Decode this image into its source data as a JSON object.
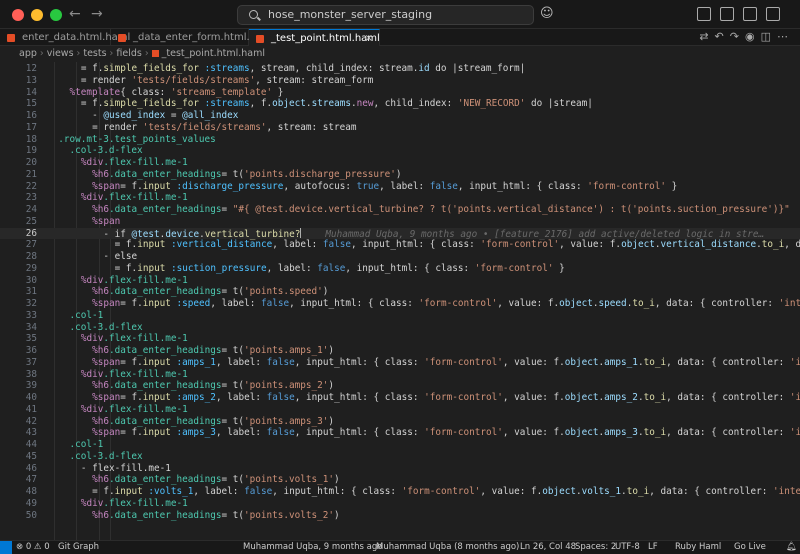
{
  "titlebar": {
    "search_text": "hose_monster_server_staging"
  },
  "tabs": [
    {
      "label": "enter_data.html.haml",
      "active": false
    },
    {
      "label": "_data_enter_form.html.haml",
      "active": false
    },
    {
      "label": "_test_point.html.haml",
      "active": true
    }
  ],
  "breadcrumb": [
    "app",
    "views",
    "tests",
    "fields",
    "_test_point.html.haml"
  ],
  "editor": {
    "current_line": 26,
    "blame": "Muhammad Uqba, 9 months ago • [feature_2176] add active/deleted logic in stre…",
    "lines": [
      {
        "n": 12,
        "indent": 6,
        "tokens": [
          [
            "= f.",
            ""
          ],
          [
            "simple_fields_for",
            "t-method"
          ],
          [
            " ",
            ""
          ],
          [
            ":streams",
            "t-sym"
          ],
          [
            ", stream, child_index: stream.",
            ""
          ],
          [
            "id",
            "t-id"
          ],
          [
            " do |stream_form|",
            ""
          ]
        ]
      },
      {
        "n": 13,
        "indent": 6,
        "tokens": [
          [
            "= render ",
            ""
          ],
          [
            "'tests/fields/streams'",
            "t-str"
          ],
          [
            ", stream: stream_form",
            ""
          ]
        ]
      },
      {
        "n": 14,
        "indent": 4,
        "tokens": [
          [
            "%template",
            "t-tag"
          ],
          [
            "{ class: ",
            ""
          ],
          [
            "'streams_template'",
            "t-str"
          ],
          [
            " }",
            ""
          ]
        ]
      },
      {
        "n": 15,
        "indent": 6,
        "tokens": [
          [
            "= f.",
            ""
          ],
          [
            "simple_fields_for",
            "t-method"
          ],
          [
            " ",
            ""
          ],
          [
            ":streams",
            "t-sym"
          ],
          [
            ", f.",
            ""
          ],
          [
            "object",
            "t-id"
          ],
          [
            ".",
            ""
          ],
          [
            "streams",
            "t-id"
          ],
          [
            ".",
            ""
          ],
          [
            "new",
            "t-kw"
          ],
          [
            ", child_index: ",
            ""
          ],
          [
            "'NEW_RECORD'",
            "t-str"
          ],
          [
            " do |stream|",
            ""
          ]
        ]
      },
      {
        "n": 16,
        "indent": 8,
        "tokens": [
          [
            "- ",
            ""
          ],
          [
            "@used_index",
            "t-ivar"
          ],
          [
            " = ",
            ""
          ],
          [
            "@all_index",
            "t-ivar"
          ]
        ]
      },
      {
        "n": 17,
        "indent": 8,
        "tokens": [
          [
            "= render ",
            ""
          ],
          [
            "'tests/fields/streams'",
            "t-str"
          ],
          [
            ", stream: stream",
            ""
          ]
        ]
      },
      {
        "n": 18,
        "indent": 2,
        "tokens": [
          [
            ".row.mt-3.test_points_values",
            "t-cls"
          ]
        ]
      },
      {
        "n": 19,
        "indent": 4,
        "tokens": [
          [
            ".col-3.d-flex",
            "t-cls"
          ]
        ]
      },
      {
        "n": 20,
        "indent": 6,
        "tokens": [
          [
            "%div",
            "t-tag"
          ],
          [
            ".flex-fill.me-1",
            "t-cls"
          ]
        ]
      },
      {
        "n": 21,
        "indent": 8,
        "tokens": [
          [
            "%h6",
            "t-tag"
          ],
          [
            ".data_enter_headings",
            "t-cls"
          ],
          [
            "= t(",
            ""
          ],
          [
            "'points.discharge_pressure'",
            "t-str"
          ],
          [
            ")",
            ""
          ]
        ]
      },
      {
        "n": 22,
        "indent": 8,
        "tokens": [
          [
            "%span",
            "t-tag"
          ],
          [
            "= f.",
            ""
          ],
          [
            "input",
            "t-method"
          ],
          [
            " ",
            ""
          ],
          [
            ":discharge_pressure",
            "t-sym"
          ],
          [
            ", autofocus: ",
            ""
          ],
          [
            "true",
            "t-const"
          ],
          [
            ", label: ",
            ""
          ],
          [
            "false",
            "t-const"
          ],
          [
            ", input_html: { class: ",
            ""
          ],
          [
            "'form-control'",
            "t-str"
          ],
          [
            " }",
            ""
          ]
        ]
      },
      {
        "n": 23,
        "indent": 6,
        "tokens": [
          [
            "%div",
            "t-tag"
          ],
          [
            ".flex-fill.me-1",
            "t-cls"
          ]
        ]
      },
      {
        "n": 24,
        "indent": 8,
        "tokens": [
          [
            "%h6",
            "t-tag"
          ],
          [
            ".data_enter_headings",
            "t-cls"
          ],
          [
            "= ",
            ""
          ],
          [
            "\"#{ @test.device.vertical_turbine? ? t('points.vertical_distance') : t('points.suction_pressure')}\"",
            "t-str"
          ]
        ]
      },
      {
        "n": 25,
        "indent": 8,
        "tokens": [
          [
            "%span",
            "t-tag"
          ]
        ]
      },
      {
        "n": 26,
        "indent": 10,
        "tokens": [
          [
            "- if ",
            ""
          ],
          [
            "@test",
            "t-ivar"
          ],
          [
            ".",
            ""
          ],
          [
            "device",
            "t-id"
          ],
          [
            ".",
            ""
          ],
          [
            "vertical_turbine?",
            "t-method"
          ]
        ]
      },
      {
        "n": 27,
        "indent": 12,
        "tokens": [
          [
            "= f.",
            ""
          ],
          [
            "input",
            "t-method"
          ],
          [
            " ",
            ""
          ],
          [
            ":vertical_distance",
            "t-sym"
          ],
          [
            ", label: ",
            ""
          ],
          [
            "false",
            "t-const"
          ],
          [
            ", input_html: { class: ",
            ""
          ],
          [
            "'form-control'",
            "t-str"
          ],
          [
            ", value: f.",
            ""
          ],
          [
            "object",
            "t-id"
          ],
          [
            ".",
            ""
          ],
          [
            "vertical_distance",
            "t-id"
          ],
          [
            ".",
            ""
          ],
          [
            "to_i",
            "t-method"
          ],
          [
            ", data: { controller",
            ""
          ]
        ]
      },
      {
        "n": 28,
        "indent": 10,
        "tokens": [
          [
            "- else",
            ""
          ]
        ]
      },
      {
        "n": 29,
        "indent": 12,
        "tokens": [
          [
            "= f.",
            ""
          ],
          [
            "input",
            "t-method"
          ],
          [
            " ",
            ""
          ],
          [
            ":suction_pressure",
            "t-sym"
          ],
          [
            ", label: ",
            ""
          ],
          [
            "false",
            "t-const"
          ],
          [
            ", input_html: { class: ",
            ""
          ],
          [
            "'form-control'",
            "t-str"
          ],
          [
            " }",
            ""
          ]
        ]
      },
      {
        "n": 30,
        "indent": 6,
        "tokens": [
          [
            "%div",
            "t-tag"
          ],
          [
            ".flex-fill.me-1",
            "t-cls"
          ]
        ]
      },
      {
        "n": 31,
        "indent": 8,
        "tokens": [
          [
            "%h6",
            "t-tag"
          ],
          [
            ".data_enter_headings",
            "t-cls"
          ],
          [
            "= t(",
            ""
          ],
          [
            "'points.speed'",
            "t-str"
          ],
          [
            ")",
            ""
          ]
        ]
      },
      {
        "n": 32,
        "indent": 8,
        "tokens": [
          [
            "%span",
            "t-tag"
          ],
          [
            "= f.",
            ""
          ],
          [
            "input",
            "t-method"
          ],
          [
            " ",
            ""
          ],
          [
            ":speed",
            "t-sym"
          ],
          [
            ", label: ",
            ""
          ],
          [
            "false",
            "t-const"
          ],
          [
            ", input_html: { class: ",
            ""
          ],
          [
            "'form-control'",
            "t-str"
          ],
          [
            ", value: f.",
            ""
          ],
          [
            "object",
            "t-id"
          ],
          [
            ".",
            ""
          ],
          [
            "speed",
            "t-id"
          ],
          [
            ".",
            ""
          ],
          [
            "to_i",
            "t-method"
          ],
          [
            ", data: { controller: ",
            ""
          ],
          [
            "'integer-dot'",
            "t-str"
          ],
          [
            " } }",
            ""
          ]
        ]
      },
      {
        "n": 33,
        "indent": 4,
        "tokens": [
          [
            ".col-1",
            "t-cls"
          ]
        ]
      },
      {
        "n": 34,
        "indent": 4,
        "tokens": [
          [
            ".col-3.d-flex",
            "t-cls"
          ]
        ]
      },
      {
        "n": 35,
        "indent": 6,
        "tokens": [
          [
            "%div",
            "t-tag"
          ],
          [
            ".flex-fill.me-1",
            "t-cls"
          ]
        ]
      },
      {
        "n": 36,
        "indent": 8,
        "tokens": [
          [
            "%h6",
            "t-tag"
          ],
          [
            ".data_enter_headings",
            "t-cls"
          ],
          [
            "= t(",
            ""
          ],
          [
            "'points.amps_1'",
            "t-str"
          ],
          [
            ")",
            ""
          ]
        ]
      },
      {
        "n": 37,
        "indent": 8,
        "tokens": [
          [
            "%span",
            "t-tag"
          ],
          [
            "= f.",
            ""
          ],
          [
            "input",
            "t-method"
          ],
          [
            " ",
            ""
          ],
          [
            ":amps_1",
            "t-sym"
          ],
          [
            ", label: ",
            ""
          ],
          [
            "false",
            "t-const"
          ],
          [
            ", input_html: { class: ",
            ""
          ],
          [
            "'form-control'",
            "t-str"
          ],
          [
            ", value: f.",
            ""
          ],
          [
            "object",
            "t-id"
          ],
          [
            ".",
            ""
          ],
          [
            "amps_1",
            "t-id"
          ],
          [
            ".",
            ""
          ],
          [
            "to_i",
            "t-method"
          ],
          [
            ", data: { controller: ",
            ""
          ],
          [
            "'integer-dot'",
            "t-str"
          ],
          [
            " } }",
            ""
          ]
        ]
      },
      {
        "n": 38,
        "indent": 6,
        "tokens": [
          [
            "%div",
            "t-tag"
          ],
          [
            ".flex-fill.me-1",
            "t-cls"
          ]
        ]
      },
      {
        "n": 39,
        "indent": 8,
        "tokens": [
          [
            "%h6",
            "t-tag"
          ],
          [
            ".data_enter_headings",
            "t-cls"
          ],
          [
            "= t(",
            ""
          ],
          [
            "'points.amps_2'",
            "t-str"
          ],
          [
            ")",
            ""
          ]
        ]
      },
      {
        "n": 40,
        "indent": 8,
        "tokens": [
          [
            "%span",
            "t-tag"
          ],
          [
            "= f.",
            ""
          ],
          [
            "input",
            "t-method"
          ],
          [
            " ",
            ""
          ],
          [
            ":amps_2",
            "t-sym"
          ],
          [
            ", label: ",
            ""
          ],
          [
            "false",
            "t-const"
          ],
          [
            ", input_html: { class: ",
            ""
          ],
          [
            "'form-control'",
            "t-str"
          ],
          [
            ", value: f.",
            ""
          ],
          [
            "object",
            "t-id"
          ],
          [
            ".",
            ""
          ],
          [
            "amps_2",
            "t-id"
          ],
          [
            ".",
            ""
          ],
          [
            "to_i",
            "t-method"
          ],
          [
            ", data: { controller: ",
            ""
          ],
          [
            "'integer-dot'",
            "t-str"
          ],
          [
            " } }",
            ""
          ]
        ]
      },
      {
        "n": 41,
        "indent": 6,
        "tokens": [
          [
            "%div",
            "t-tag"
          ],
          [
            ".flex-fill.me-1",
            "t-cls"
          ]
        ]
      },
      {
        "n": 42,
        "indent": 8,
        "tokens": [
          [
            "%h6",
            "t-tag"
          ],
          [
            ".data_enter_headings",
            "t-cls"
          ],
          [
            "= t(",
            ""
          ],
          [
            "'points.amps_3'",
            "t-str"
          ],
          [
            ")",
            ""
          ]
        ]
      },
      {
        "n": 43,
        "indent": 8,
        "tokens": [
          [
            "%span",
            "t-tag"
          ],
          [
            "= f.",
            ""
          ],
          [
            "input",
            "t-method"
          ],
          [
            " ",
            ""
          ],
          [
            ":amps_3",
            "t-sym"
          ],
          [
            ", label: ",
            ""
          ],
          [
            "false",
            "t-const"
          ],
          [
            ", input_html: { class: ",
            ""
          ],
          [
            "'form-control'",
            "t-str"
          ],
          [
            ", value: f.",
            ""
          ],
          [
            "object",
            "t-id"
          ],
          [
            ".",
            ""
          ],
          [
            "amps_3",
            "t-id"
          ],
          [
            ".",
            ""
          ],
          [
            "to_i",
            "t-method"
          ],
          [
            ", data: { controller: ",
            ""
          ],
          [
            "'integer-dot'",
            "t-str"
          ],
          [
            " } }",
            ""
          ]
        ]
      },
      {
        "n": 44,
        "indent": 4,
        "tokens": [
          [
            ".col-1",
            "t-cls"
          ]
        ]
      },
      {
        "n": 45,
        "indent": 4,
        "tokens": [
          [
            ".col-3.d-flex",
            "t-cls"
          ]
        ]
      },
      {
        "n": 46,
        "indent": 6,
        "tokens": [
          [
            "- flex-fill.me-1",
            ""
          ]
        ]
      },
      {
        "n": 47,
        "indent": 8,
        "tokens": [
          [
            "%h6",
            "t-tag"
          ],
          [
            ".data_enter_headings",
            "t-cls"
          ],
          [
            "= t(",
            ""
          ],
          [
            "'points.volts_1'",
            "t-str"
          ],
          [
            ")",
            ""
          ]
        ]
      },
      {
        "n": 48,
        "indent": 8,
        "tokens": [
          [
            "= f.",
            ""
          ],
          [
            "input",
            "t-method"
          ],
          [
            " ",
            ""
          ],
          [
            ":volts_1",
            "t-sym"
          ],
          [
            ", label: ",
            ""
          ],
          [
            "false",
            "t-const"
          ],
          [
            ", input_html: { class: ",
            ""
          ],
          [
            "'form-control'",
            "t-str"
          ],
          [
            ", value: f.",
            ""
          ],
          [
            "object",
            "t-id"
          ],
          [
            ".",
            ""
          ],
          [
            "volts_1",
            "t-id"
          ],
          [
            ".",
            ""
          ],
          [
            "to_i",
            "t-method"
          ],
          [
            ", data: { controller: ",
            ""
          ],
          [
            "'integer-dot'",
            "t-str"
          ],
          [
            " } }",
            ""
          ]
        ]
      },
      {
        "n": 49,
        "indent": 6,
        "tokens": [
          [
            "%div",
            "t-tag"
          ],
          [
            ".flex-fill.me-1",
            "t-cls"
          ]
        ]
      },
      {
        "n": 50,
        "indent": 8,
        "tokens": [
          [
            "%h6",
            "t-tag"
          ],
          [
            ".data_enter_headings",
            "t-cls"
          ],
          [
            "= t(",
            ""
          ],
          [
            "'points.volts_2'",
            "t-str"
          ],
          [
            ")",
            ""
          ]
        ]
      }
    ]
  },
  "statusbar": {
    "branch": "Git Graph",
    "blame_short": "Muhammad Uqba, 9 months ago",
    "blame_long": "Muhammad Uqba (8 months ago)",
    "position": "Ln 26, Col 48",
    "spaces": "Spaces: 2",
    "encoding": "UTF-8",
    "eol": "LF",
    "language": "Ruby Haml",
    "golive": "Go Live"
  }
}
